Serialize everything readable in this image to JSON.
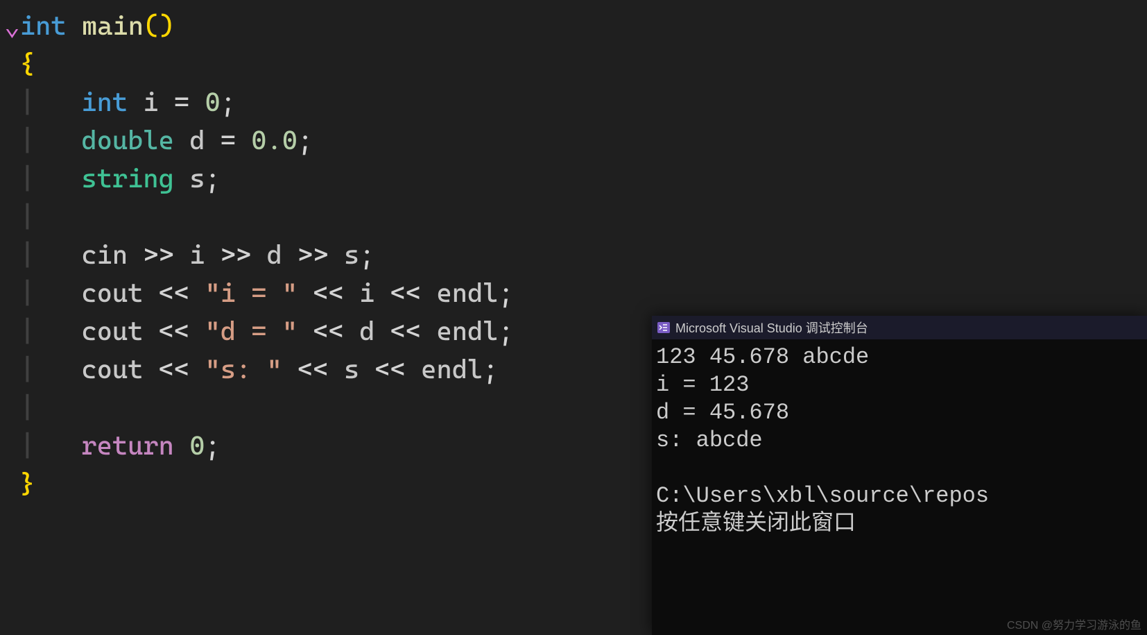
{
  "code": {
    "l1_kw": "int",
    "l1_fn": "main",
    "l1_par": "()",
    "l2": "{",
    "l3_type": "int",
    "l3_ident": "i",
    "l3_op": "=",
    "l3_num": "0",
    "l3_semi": ";",
    "l4_type": "double",
    "l4_ident": "d",
    "l4_op": "=",
    "l4_num": "0.0",
    "l4_semi": ";",
    "l5_type": "string",
    "l5_ident": "s",
    "l5_semi": ";",
    "l6_cin": "cin",
    "l6_op": ">>",
    "l6_i": "i",
    "l6_d": "d",
    "l6_s": "s",
    "l6_semi": ";",
    "l7_cout": "cout",
    "l7_op": "<<",
    "l7_str": "\"i = \"",
    "l7_i": "i",
    "l7_endl": "endl",
    "l7_semi": ";",
    "l8_cout": "cout",
    "l8_op": "<<",
    "l8_str": "\"d = \"",
    "l8_d": "d",
    "l8_endl": "endl",
    "l8_semi": ";",
    "l9_cout": "cout",
    "l9_op": "<<",
    "l9_str": "\"s: \"",
    "l9_s": "s",
    "l9_endl": "endl",
    "l9_semi": ";",
    "l10_kw": "return",
    "l10_num": "0",
    "l10_semi": ";",
    "l11": "}"
  },
  "console": {
    "title": "Microsoft Visual Studio 调试控制台",
    "lines": [
      "123 45.678 abcde",
      "i = 123",
      "d = 45.678",
      "s: abcde",
      "",
      "C:\\Users\\xbl\\source\\repos",
      "按任意键关闭此窗口"
    ]
  },
  "watermark": "CSDN @努力学习游泳的鱼"
}
